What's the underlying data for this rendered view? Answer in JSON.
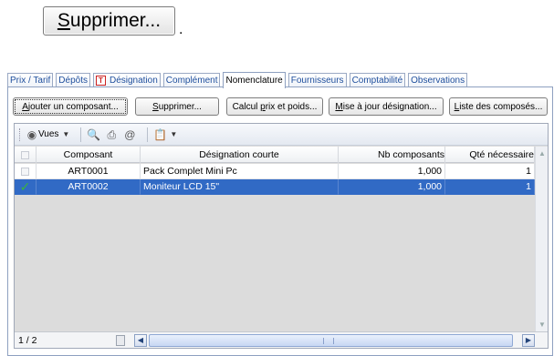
{
  "highlight_button": {
    "accel": "S",
    "rest": "upprimer..."
  },
  "tabs": [
    {
      "label": "Prix / Tarif"
    },
    {
      "label": "Dépôts"
    },
    {
      "label": "Désignation",
      "icon": "red-t-icon"
    },
    {
      "label": "Complément"
    },
    {
      "label": "Nomenclature",
      "active": true
    },
    {
      "label": "Fournisseurs"
    },
    {
      "label": "Comptabilité"
    },
    {
      "label": "Observations"
    }
  ],
  "actions": {
    "ajouter": {
      "accel": "A",
      "rest": "jouter un composant..."
    },
    "supprimer": {
      "accel": "S",
      "rest": "upprimer..."
    },
    "calcul": {
      "pre": "Calcul ",
      "accel": "p",
      "rest": "rix et poids..."
    },
    "mise": {
      "accel": "M",
      "rest": "ise à jour désignation..."
    },
    "liste": {
      "accel": "L",
      "rest": "iste des composés..."
    }
  },
  "toolbar": {
    "vues_label": "Vues",
    "icons": [
      "eye-icon",
      "print-preview-icon",
      "print-icon",
      "email-icon",
      "clipboard-icon"
    ]
  },
  "grid": {
    "columns": [
      "Composant",
      "Désignation courte",
      "Nb composants",
      "Qté nécessaire"
    ],
    "rows": [
      {
        "composant": "ART0001",
        "designation": "Pack Complet Mini Pc",
        "nb": "1,000",
        "qte": "1",
        "checked": false
      },
      {
        "composant": "ART0002",
        "designation": "Moniteur LCD 15\"",
        "nb": "1,000",
        "qte": "1",
        "checked": true
      }
    ],
    "page_info": "1 / 2"
  },
  "colors": {
    "selection": "#316ac5",
    "tab_text": "#1f4f9d",
    "check": "#3cb43c"
  }
}
